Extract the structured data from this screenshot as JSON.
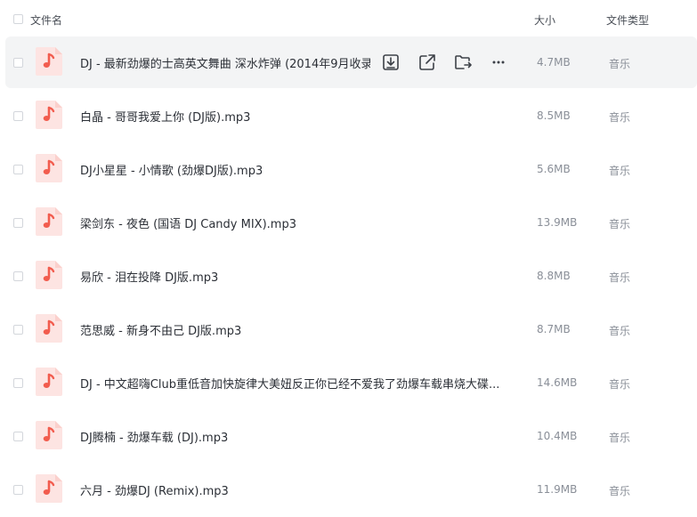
{
  "header": {
    "name_label": "文件名",
    "size_label": "大小",
    "type_label": "文件类型"
  },
  "files": [
    {
      "name": "DJ - 最新劲爆的士高英文舞曲 深水炸弹 (2014年9月收录",
      "size": "4.7MB",
      "type": "音乐"
    },
    {
      "name": "白晶 - 哥哥我爱上你 (DJ版).mp3",
      "size": "8.5MB",
      "type": "音乐"
    },
    {
      "name": "DJ小星星 - 小情歌 (劲爆DJ版).mp3",
      "size": "5.6MB",
      "type": "音乐"
    },
    {
      "name": "梁剑东 - 夜色 (国语 DJ Candy MIX).mp3",
      "size": "13.9MB",
      "type": "音乐"
    },
    {
      "name": "易欣 - 泪在投降 DJ版.mp3",
      "size": "8.8MB",
      "type": "音乐"
    },
    {
      "name": "范思威 - 新身不由己 DJ版.mp3",
      "size": "8.7MB",
      "type": "音乐"
    },
    {
      "name": "DJ - 中文超嗨Club重低音加快旋律大美妞反正你已经不爱我了劲爆车载串烧大碟...",
      "size": "14.6MB",
      "type": "音乐"
    },
    {
      "name": "DJ腾楠 - 劲爆车载 (DJ).mp3",
      "size": "10.4MB",
      "type": "音乐"
    },
    {
      "name": "六月 - 劲爆DJ (Remix).mp3",
      "size": "11.9MB",
      "type": "音乐"
    }
  ],
  "row_actions": [
    "download-icon",
    "share-icon",
    "move-folder-icon",
    "more-icon"
  ],
  "colors": {
    "icon_bg": "#fde4e2",
    "icon_note": "#f25c4e",
    "hover_row": "#f3f4f5"
  }
}
